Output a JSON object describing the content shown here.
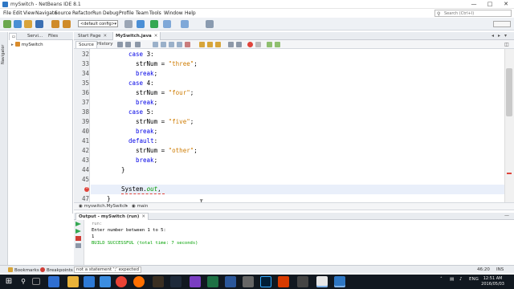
{
  "window": {
    "title": "mySwitch - NetBeans IDE 8.1"
  },
  "menu": [
    "File",
    "Edit",
    "View",
    "Navigate",
    "Source",
    "Refactor",
    "Run",
    "Debug",
    "Profile",
    "Team",
    "Tools",
    "Window",
    "Help"
  ],
  "search": {
    "placeholder": "Search (Ctrl+I)"
  },
  "toolbar": {
    "config_value": "<default config>"
  },
  "panels": {
    "left_tabs": [
      "Servi...",
      "Files"
    ],
    "navigator_label": "Navigator",
    "project_name": "mySwitch"
  },
  "editor": {
    "tabs": [
      "Start Page",
      "MySwitch.java"
    ],
    "source_tab": "Source",
    "history_tab": "History",
    "lines": [
      {
        "n": "32",
        "tokens": [
          [
            "kw",
            "case"
          ],
          [
            "",
            " 3:"
          ]
        ],
        "indent": 10
      },
      {
        "n": "33",
        "tokens": [
          [
            "",
            "strNum = "
          ],
          [
            "str",
            "\"three\""
          ],
          [
            "",
            ";"
          ]
        ],
        "indent": 12
      },
      {
        "n": "34",
        "tokens": [
          [
            "kw",
            "break"
          ],
          [
            "",
            ";"
          ]
        ],
        "indent": 12
      },
      {
        "n": "35",
        "tokens": [
          [
            "kw",
            "case"
          ],
          [
            "",
            " 4:"
          ]
        ],
        "indent": 10
      },
      {
        "n": "36",
        "tokens": [
          [
            "",
            "strNum = "
          ],
          [
            "str",
            "\"four\""
          ],
          [
            "",
            ";"
          ]
        ],
        "indent": 12
      },
      {
        "n": "37",
        "tokens": [
          [
            "kw",
            "break"
          ],
          [
            "",
            ";"
          ]
        ],
        "indent": 12
      },
      {
        "n": "38",
        "tokens": [
          [
            "kw",
            "case"
          ],
          [
            "",
            " 5:"
          ]
        ],
        "indent": 10
      },
      {
        "n": "39",
        "tokens": [
          [
            "",
            "strNum = "
          ],
          [
            "str",
            "\"five\""
          ],
          [
            "",
            ";"
          ]
        ],
        "indent": 12
      },
      {
        "n": "40",
        "tokens": [
          [
            "kw",
            "break"
          ],
          [
            "",
            ";"
          ]
        ],
        "indent": 12
      },
      {
        "n": "41",
        "tokens": [
          [
            "kw",
            "default"
          ],
          [
            "",
            ":"
          ]
        ],
        "indent": 10
      },
      {
        "n": "42",
        "tokens": [
          [
            "",
            "strNum = "
          ],
          [
            "str",
            "\"other\""
          ],
          [
            "",
            ";"
          ]
        ],
        "indent": 12
      },
      {
        "n": "43",
        "tokens": [
          [
            "kw",
            "break"
          ],
          [
            "",
            ";"
          ]
        ],
        "indent": 12
      },
      {
        "n": "44",
        "tokens": [
          [
            "",
            "}"
          ]
        ],
        "indent": 8
      },
      {
        "n": "45",
        "tokens": [],
        "indent": 0
      },
      {
        "n": "",
        "tokens": [
          [
            "",
            "System."
          ],
          [
            "fld",
            "out"
          ],
          [
            "",
            ","
          ]
        ],
        "indent": 8
      },
      {
        "n": "47",
        "tokens": [
          [
            "",
            "}"
          ]
        ],
        "indent": 4
      }
    ]
  },
  "breadcrumb": [
    "myswitch.MySwitch",
    "main"
  ],
  "output": {
    "tab_label": "Output - mySwitch (run)",
    "lines": [
      {
        "text": "run:",
        "color": "#888888"
      },
      {
        "text": "Enter number between 1 to 5:",
        "color": "#000000"
      },
      {
        "text": "1",
        "color": "#000000"
      },
      {
        "text": "BUILD SUCCESSFUL (total time: 7 seconds)",
        "color": "#00a000"
      }
    ]
  },
  "bottom_tabs": [
    "Bookmarks",
    "Breakpoints"
  ],
  "status": {
    "message": "not a statement  ';' expected",
    "position": "46:20",
    "mode": "INS"
  },
  "taskbar": {
    "lang": "ENG",
    "time": "12:51 AM",
    "date": "2016/05/03"
  },
  "colors": {
    "keyword": "#0000e6",
    "string": "#ce7b00",
    "field": "#009900",
    "success": "#00a000",
    "error": "#e0443b"
  }
}
